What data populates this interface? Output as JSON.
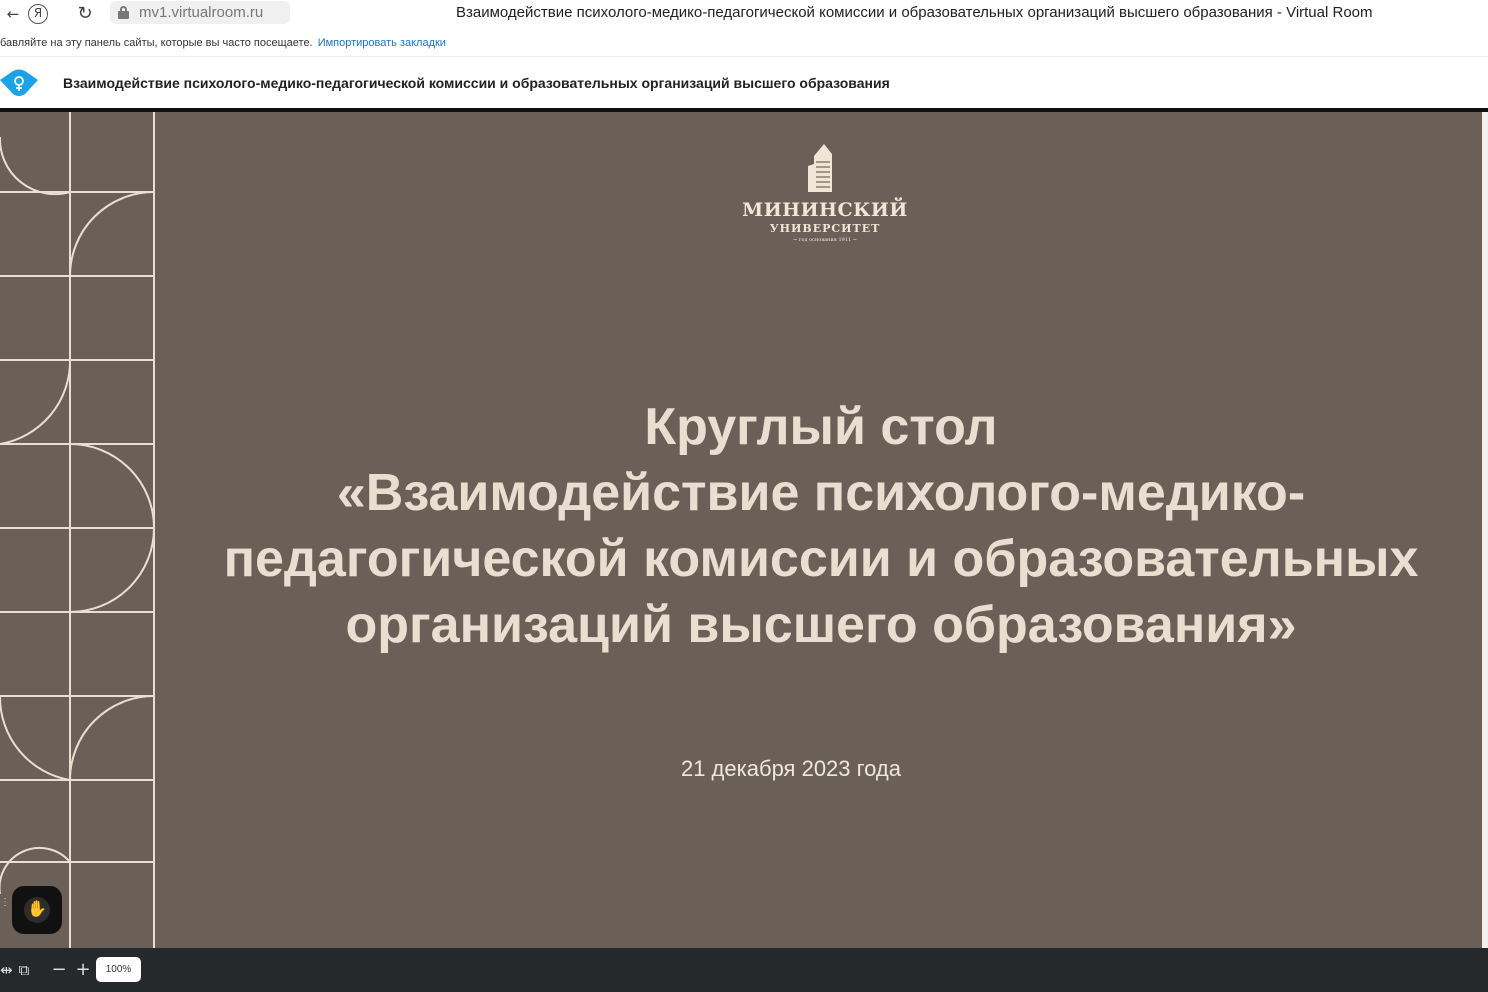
{
  "browser": {
    "url": "mv1.virtualroom.ru",
    "tab_title": "Взаимодействие психолого-медико-педагогической комиссии и образовательных организаций высшего образования - Virtual Room",
    "back_glyph": "←",
    "yandex_glyph": "Я",
    "reload_glyph": "↻"
  },
  "bookmarks_bar": {
    "hint": "бавляйте на эту панель сайты, которые вы часто посещаете.",
    "import_link": "Импортировать закладки"
  },
  "app_header": {
    "title": "Взаимодействие психолого-медико-педагогической комиссии и образовательных организаций высшего образования",
    "logo_icon": "virtualroom-logo-icon",
    "accent_color": "#1aa3e6"
  },
  "slide": {
    "background_color": "#6b6058",
    "text_color": "#e8dfd1",
    "logo": {
      "name": "МИНИНСКИЙ",
      "subtitle": "УНИВЕРСИТЕТ",
      "founded": "~ год основания 1911 ~"
    },
    "heading_lines": [
      "Круглый стол",
      "«Взаимодействие психолого-медико-",
      "педагогической комиссии и образовательных",
      "организаций высшего образования»"
    ],
    "date": "21 декабря 2023 года"
  },
  "raise_hand": {
    "icon": "hand-icon",
    "glyph": "✋"
  },
  "bottom_toolbar": {
    "fit_width_glyph": "⇹",
    "fit_page_glyph": "⧉",
    "zoom_out_glyph": "−",
    "zoom_in_glyph": "+",
    "zoom_level": "100%"
  }
}
